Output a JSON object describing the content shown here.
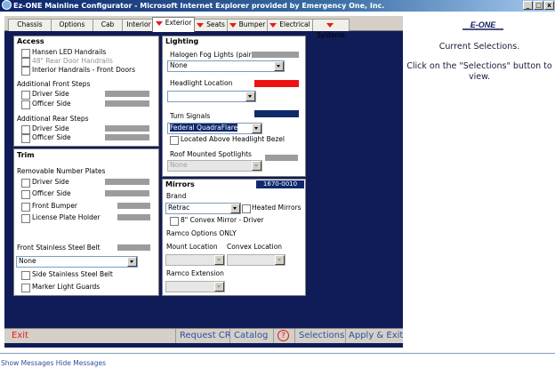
{
  "window": {
    "title": "Ez-ONE Mainline Configurator - Microsoft Internet Explorer provided by Emergency One, Inc.",
    "minimize": "_",
    "restore": "□",
    "close": "x"
  },
  "tabs": [
    {
      "label": "Chassis",
      "flag": false
    },
    {
      "label": "Options",
      "flag": false
    },
    {
      "label": "Cab",
      "flag": false
    },
    {
      "label": "Interior",
      "flag": false
    },
    {
      "label": "Exterior",
      "flag": true
    },
    {
      "label": "Seats",
      "flag": true
    },
    {
      "label": "Bumper",
      "flag": true
    },
    {
      "label": "Electrical",
      "flag": true
    },
    {
      "label": "Systems",
      "flag": true
    }
  ],
  "access": {
    "heading": "Access",
    "items": [
      "Hansen LED Handrails",
      "48\" Rear Door Handrails",
      "Interior Handrails - Front Doors"
    ],
    "front_steps_label": "Additional Front Steps",
    "front_driver": "Driver Side",
    "front_officer": "Officer Side",
    "rear_steps_label": "Additional Rear Steps",
    "rear_driver": "Driver Side",
    "rear_officer": "Officer Side"
  },
  "trim": {
    "heading": "Trim",
    "plates_label": "Removable Number Plates",
    "driver": "Driver Side",
    "officer": "Officer Side",
    "front_bumper": "Front Bumper",
    "license_plate": "License Plate Holder",
    "belt_label": "Front Stainless Steel Belt",
    "belt_value": "None",
    "side_belt": "Side Stainless Steel Belt",
    "marker_guards": "Marker Light Guards"
  },
  "lighting": {
    "heading": "Lighting",
    "fog_label": "Halogen Fog Lights (pair)",
    "fog_value": "None",
    "headlight_label": "Headlight Location",
    "headlight_value": "",
    "turn_label": "Turn Signals",
    "turn_value": "Federal QuadraFlare",
    "bezel_label": "Located Above Headlight Bezel",
    "spot_label": "Roof Mounted Spotlights",
    "spot_value": "None"
  },
  "mirrors": {
    "heading": "Mirrors",
    "part_no": "1670-0010",
    "brand_label": "Brand",
    "brand_value": "Retrac",
    "heated": "Heated Mirrors",
    "convex": "8\" Convex Mirror - Driver",
    "ramco_only": "Ramco Options ONLY",
    "mount_label": "Mount Location",
    "convex_loc_label": "Convex Location",
    "extension_label": "Ramco Extension"
  },
  "footer": {
    "exit": "Exit",
    "request_cr": "Request CR",
    "catalog": "Catalog",
    "help": "?",
    "selections": "Selections",
    "apply_exit": "Apply & Exit"
  },
  "side": {
    "logo": "E-ONE",
    "current": "Current Selections.",
    "hint": "Click on the \"Selections\" button to view."
  },
  "messages": {
    "show": "Show Messages",
    "hide": "Hide Messages"
  },
  "colors": {
    "app_bg": "#0f1c57",
    "headlight_swatch": "#ee1111",
    "turn_swatch": "#0f2a6b",
    "tab_flag": "#e81a1a"
  }
}
